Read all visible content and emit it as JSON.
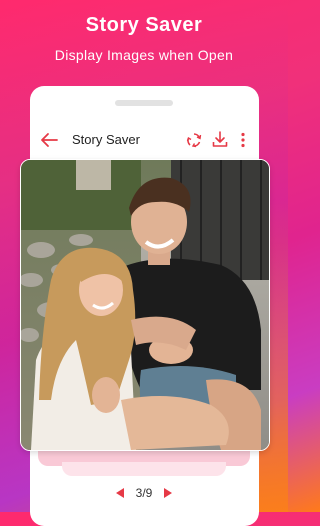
{
  "promo": {
    "headline": "Story Saver",
    "subline": "Display Images when Open"
  },
  "toolbar": {
    "title": "Story Saver",
    "icons": [
      "back-arrow-icon",
      "repost-icon",
      "download-icon",
      "more-vert-icon"
    ]
  },
  "viewer": {
    "current": "3/9"
  },
  "colors": {
    "accent": "#e63946",
    "gradient_start": "#ff2a6d",
    "gradient_end": "#ff7a1a"
  }
}
